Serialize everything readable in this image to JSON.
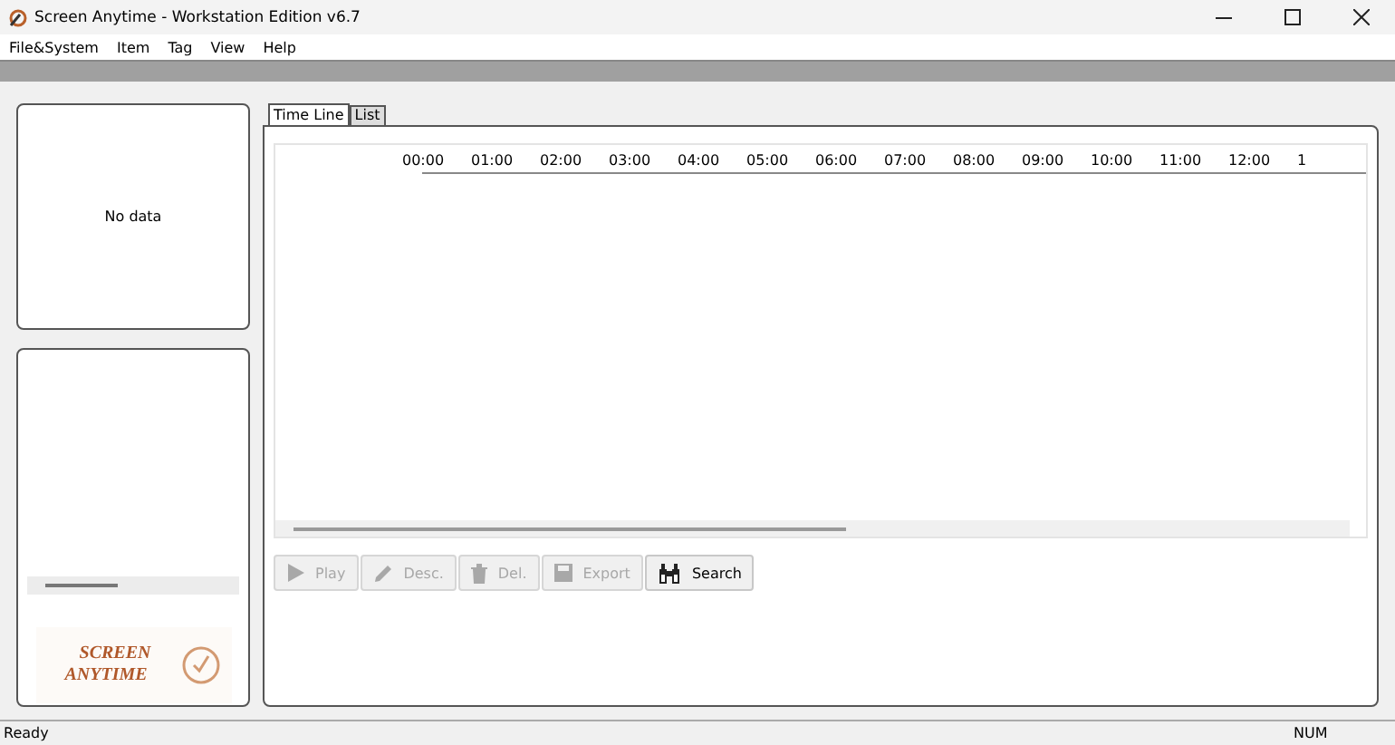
{
  "window": {
    "title": "Screen Anytime - Workstation Edition v6.7"
  },
  "menu": [
    "File&System",
    "Item",
    "Tag",
    "View",
    "Help"
  ],
  "left_panel": {
    "message": "No data",
    "logo": [
      "SCREEN",
      "ANYTIME"
    ]
  },
  "tabs": [
    {
      "label": "Time Line",
      "selected": true
    },
    {
      "label": "List",
      "selected": false
    }
  ],
  "timeline": {
    "hours": [
      "00:00",
      "01:00",
      "02:00",
      "03:00",
      "04:00",
      "05:00",
      "06:00",
      "07:00",
      "08:00",
      "09:00",
      "10:00",
      "11:00",
      "12:00",
      "1"
    ]
  },
  "buttons": [
    {
      "label": "Play",
      "kind": "play",
      "disabled": true
    },
    {
      "label": "Desc.",
      "kind": "edit",
      "disabled": true
    },
    {
      "label": "Del.",
      "kind": "delete",
      "disabled": true
    },
    {
      "label": "Export",
      "kind": "export",
      "disabled": true
    },
    {
      "label": "Search",
      "kind": "search",
      "disabled": false
    }
  ],
  "status_bar": {
    "message": "Ready",
    "indicator": "NUM"
  }
}
